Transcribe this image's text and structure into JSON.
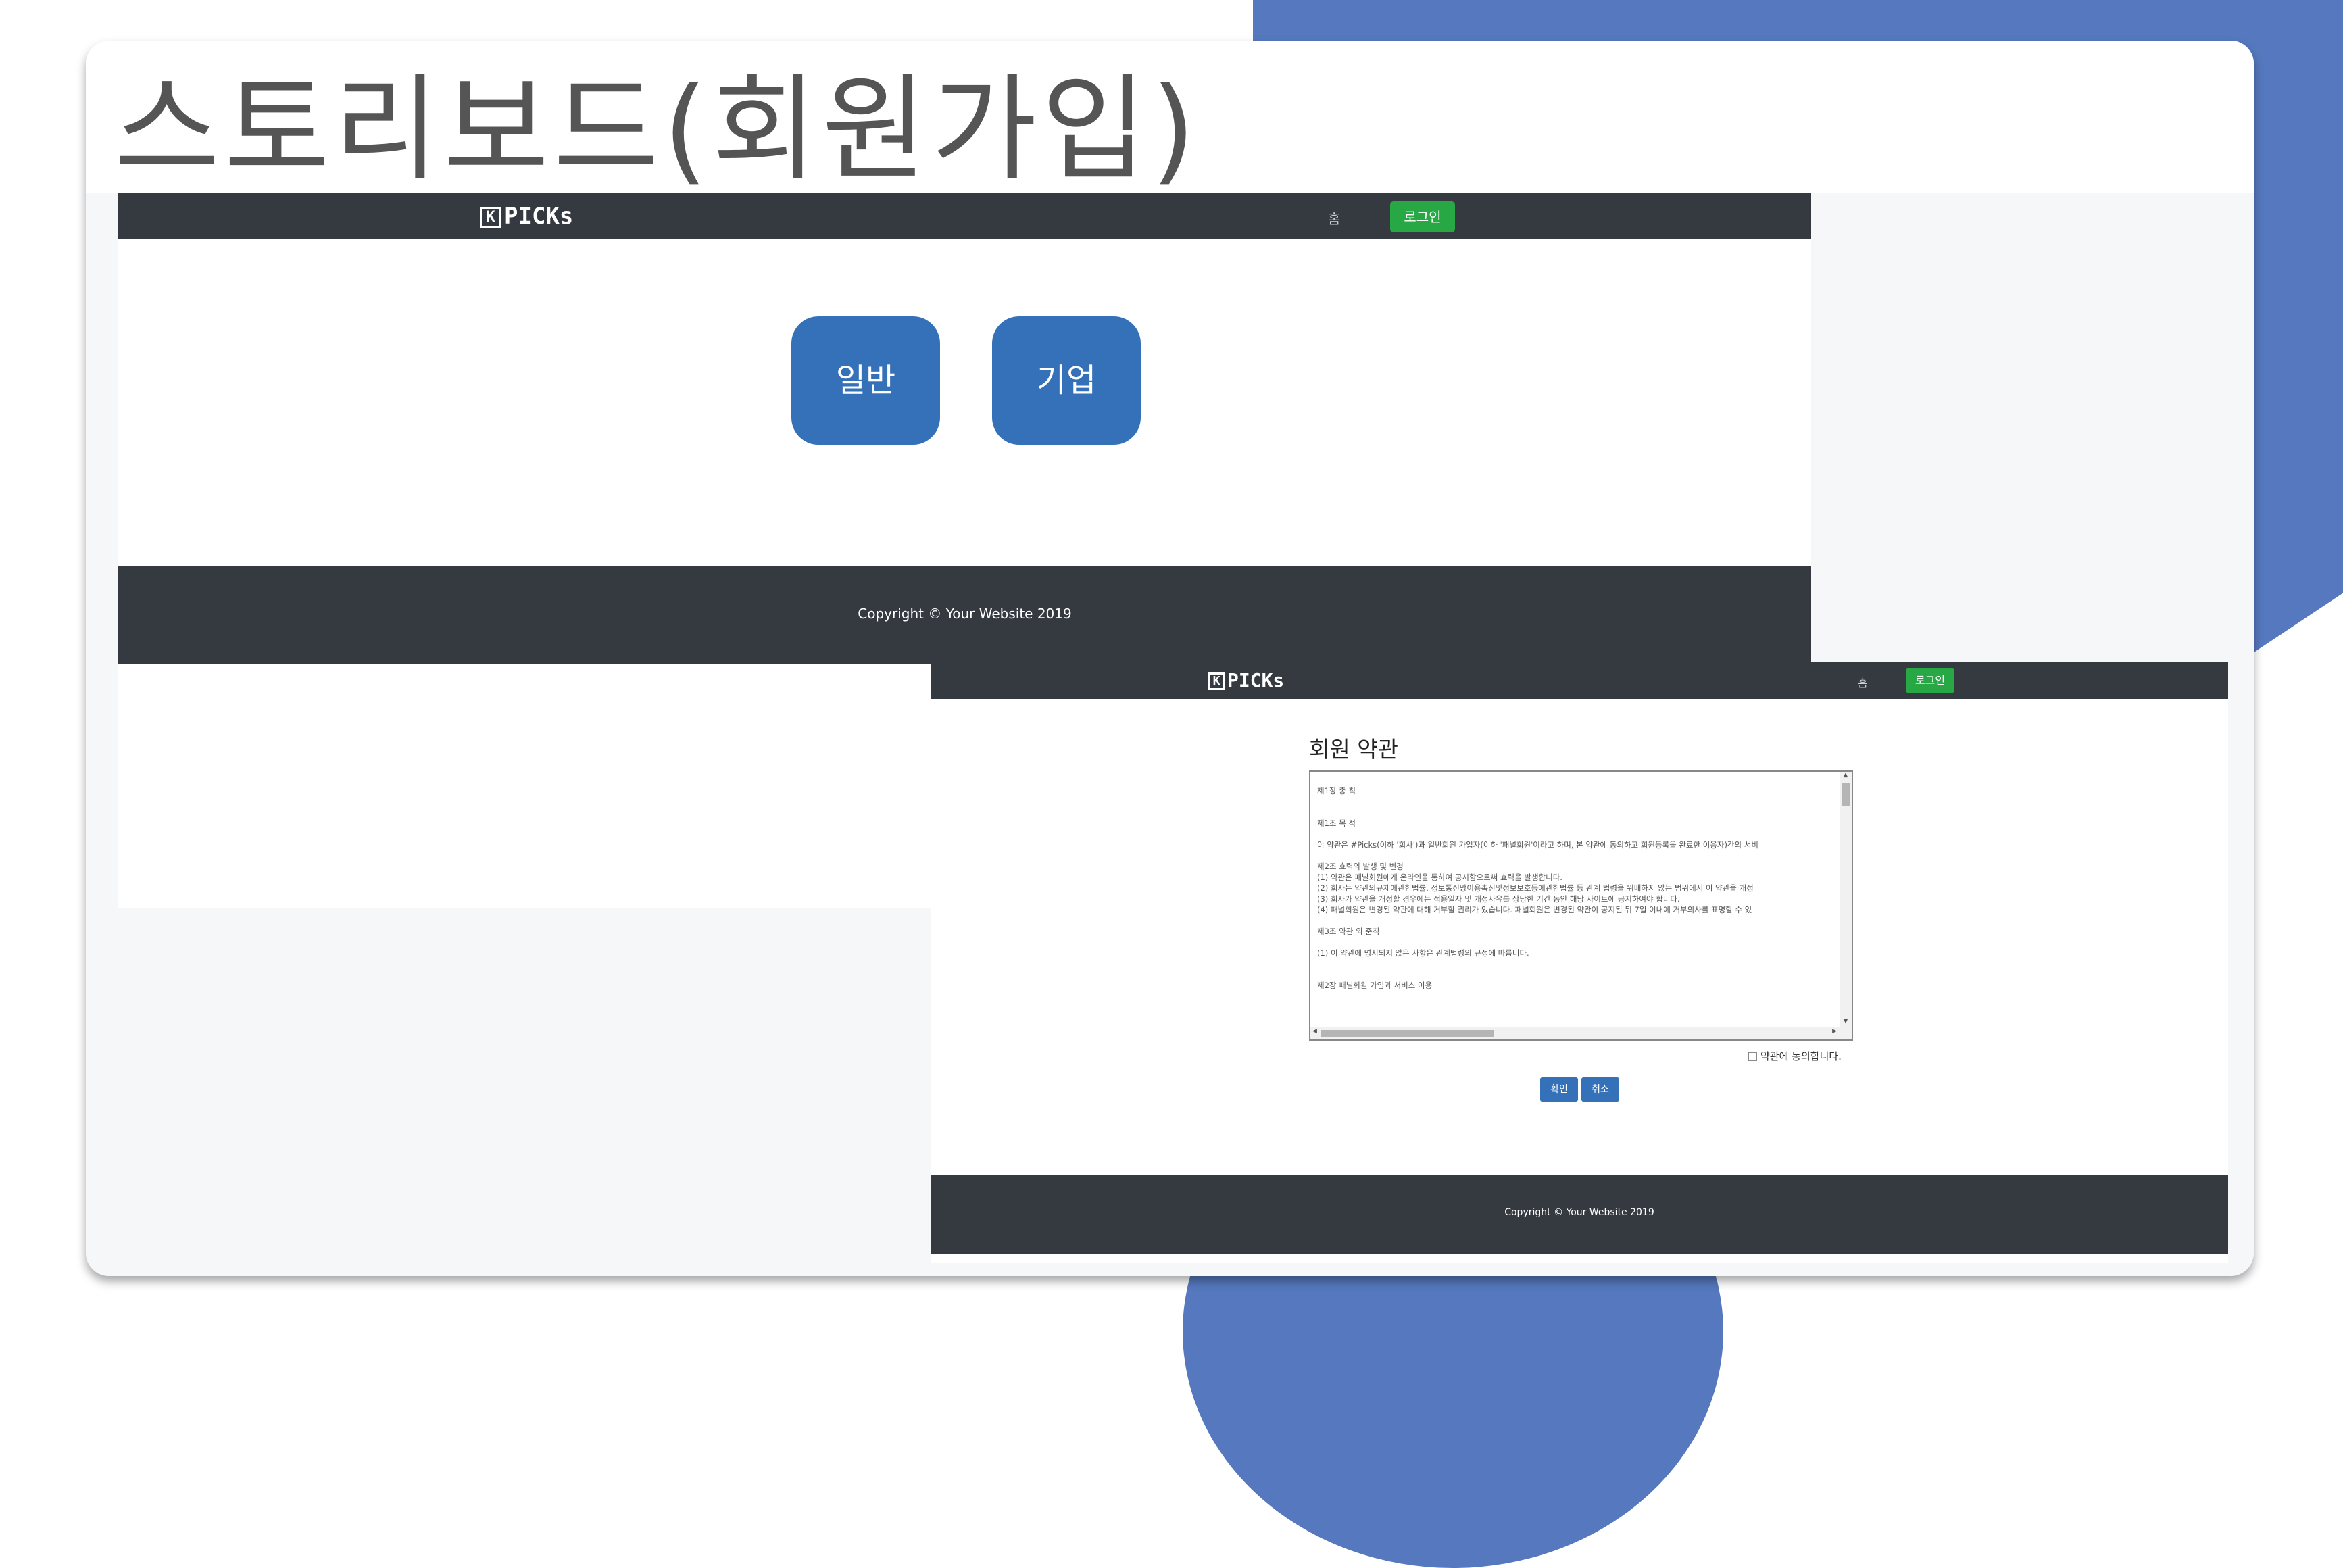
{
  "slide": {
    "title": "스토리보드(회원가입)"
  },
  "screen_one": {
    "brand": {
      "mark": "K",
      "text": "PICKs"
    },
    "nav_home": "홈",
    "login_label": "로그인",
    "member_types": [
      "일반",
      "기업"
    ],
    "copyright": "Copyright © Your Website 2019"
  },
  "screen_two": {
    "brand": {
      "mark": "K",
      "text": "PICKs"
    },
    "nav_home": "홈",
    "login_label": "로그인",
    "terms_title": "회원 약관",
    "terms_lines": [
      "제1장 총 칙",
      "",
      "",
      "제1조 목 적",
      "",
      "이 약관은 #Picks(이하 '회사')과 일반회원 가입자(이하 '패널회원'이라고 하며, 본 약관에 동의하고 회원등록을 완료한 이용자)간의 서비",
      "",
      "제2조 효력의 발생 및 변경",
      "(1) 약관은 패널회원에게 온라인을 통하여 공시함으로써 효력을 발생합니다.",
      "(2) 회사는 약관의규제에관한법률, 정보통신망이용촉진및정보보호등에관한법률 등 관계 법령을 위배하지 않는 범위에서 이 약관을 개정",
      "(3) 회사가 약관을 개정할 경우에는 적용일자 및 개정사유를 상당한 기간 동안 해당 사이트에 공지하여야 합니다.",
      "(4) 패널회원은 변경된 약관에 대해 거부할 권리가 있습니다. 패널회원은 변경된 약관이 공지된 뒤 7일 이내에 거부의사를 표명할 수 있",
      "",
      "제3조 약관 외 준칙",
      "",
      "(1) 이 약관에 명시되지 않은 사항은 관계법령의 규정에 따릅니다.",
      "",
      "",
      "제2장 패널회원 가입과 서비스 이용"
    ],
    "agree_label": "약관에 동의합니다.",
    "confirm_label": "확인",
    "cancel_label": "취소",
    "copyright": "Copyright © Your Website 2019"
  }
}
